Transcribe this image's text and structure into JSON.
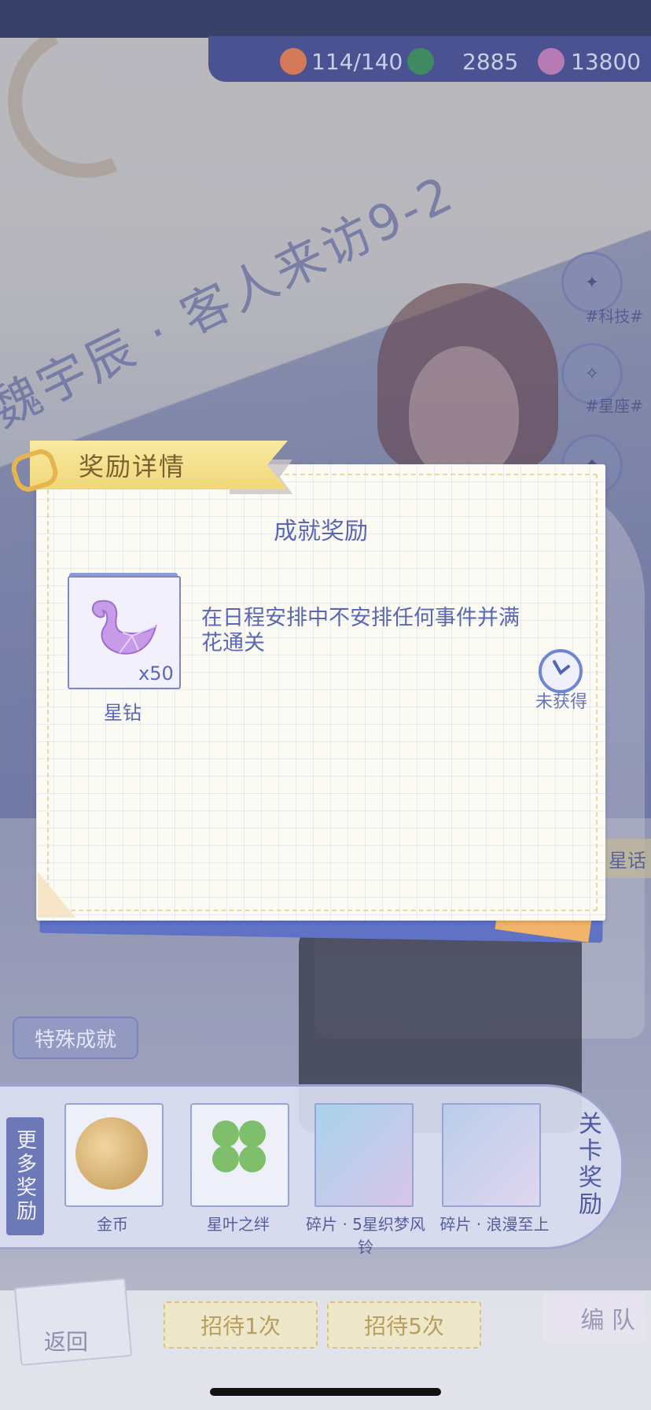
{
  "resources": {
    "stamina": "114/140",
    "leaves": "2885",
    "diamonds": "13800"
  },
  "stage_title": "魏宇辰 · 客人来访9-2",
  "side_tags": [
    "#科技#",
    "#星座#"
  ],
  "side_tab_right": "星话",
  "modal": {
    "ribbon": "奖励详情",
    "title": "成就奖励",
    "reward": {
      "name": "星钻",
      "quantity": "x50"
    },
    "description": "在日程安排中不安排任何事件并满花通关",
    "status": "未获得"
  },
  "special_achievement": "特殊成就",
  "rewards_strip": {
    "left_label": "更多奖励",
    "right_label": "关卡奖励",
    "items": [
      {
        "label": "金币"
      },
      {
        "label": "星叶之绊"
      },
      {
        "label": "碎片 · 5星织梦风铃"
      },
      {
        "label": "碎片 · 浪漫至上"
      }
    ]
  },
  "bottom": {
    "back": "返回",
    "recruit1": "招待1次",
    "recruit5": "招待5次",
    "team": "编 队"
  }
}
